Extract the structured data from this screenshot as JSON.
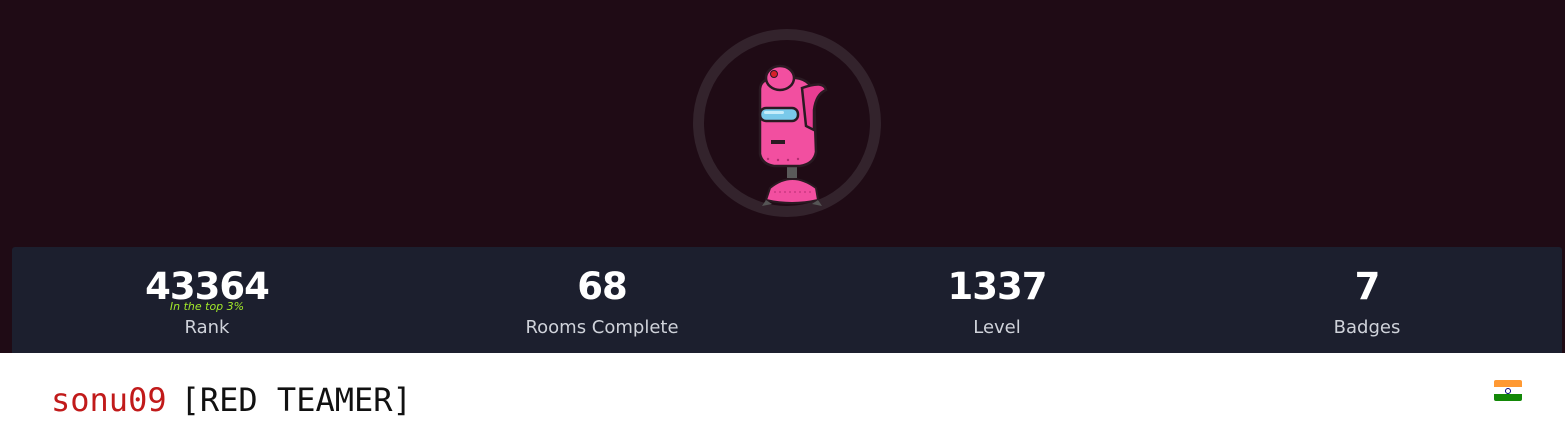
{
  "profile": {
    "username": "sonu09",
    "title": "[RED TEAMER]",
    "avatar_icon": "pink-robot-avatar-icon",
    "country_flag_icon": "india-flag-icon"
  },
  "stats": {
    "rank": {
      "value": "43364",
      "label": "Rank",
      "note": "In the top 3%"
    },
    "rooms": {
      "value": "68",
      "label": "Rooms Complete"
    },
    "level": {
      "value": "1337",
      "label": "Level"
    },
    "badges": {
      "value": "7",
      "label": "Badges"
    }
  },
  "colors": {
    "banner_bg": "#1f0b15",
    "stats_bg": "#1c1f2e",
    "username": "#c11a1a",
    "rank_note": "#a3ea2a"
  }
}
